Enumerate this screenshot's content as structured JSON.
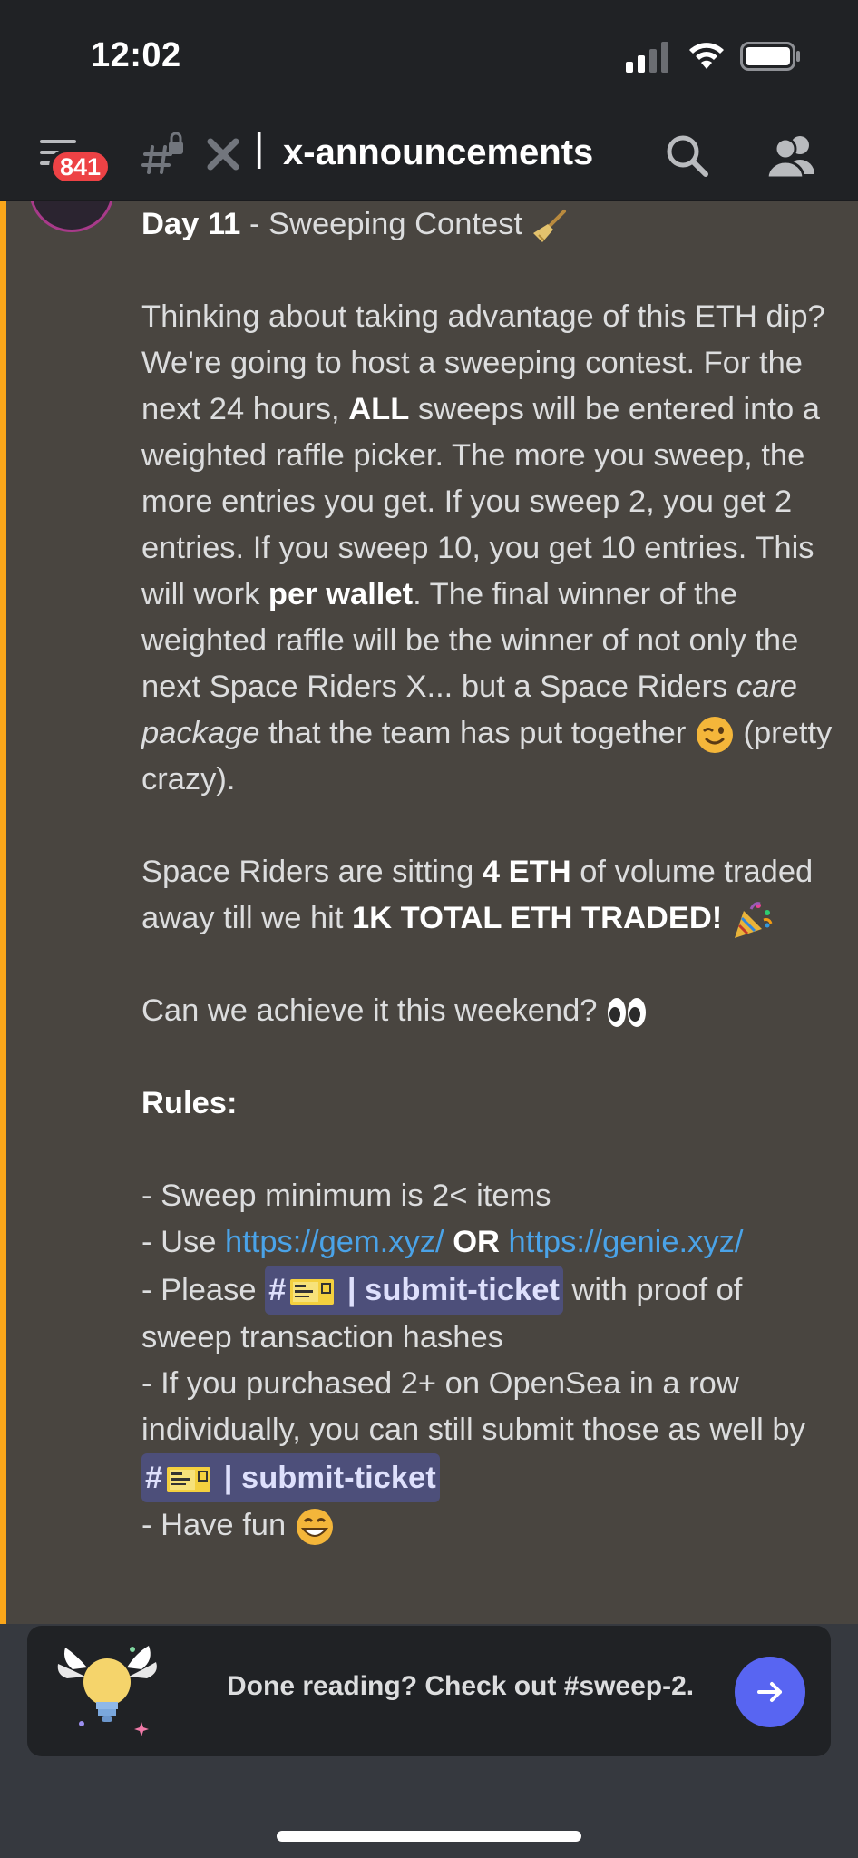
{
  "status_bar": {
    "time": "12:02"
  },
  "header": {
    "unread_count": "841",
    "divider": "|",
    "channel_name": "x-announcements"
  },
  "message": {
    "title_bold": "Day 11",
    "title_rest": " - Sweeping Contest ",
    "p1_a": "Thinking about taking advantage of this ETH dip? We're going to host a sweeping contest. For the next 24 hours, ",
    "p1_b": "ALL",
    "p1_c": " sweeps will be entered into a weighted raffle picker.  The more you sweep, the more entries you get.  If you sweep 2, you get 2 entries.  If you sweep 10, you get 10 entries.  This will work ",
    "p1_d": "per wallet",
    "p1_e": ". The final winner of the weighted raffle will be the winner of not only the next Space Riders X... but a Space Riders ",
    "p1_f": "care package",
    "p1_g": " that the team has put together ",
    "p1_h": " (pretty crazy).",
    "p2_a": "Space Riders are sitting ",
    "p2_b": "4 ETH",
    "p2_c": " of volume traded away till we hit ",
    "p2_d": "1K TOTAL ETH TRADED!",
    "p3": "Can we achieve it this weekend? ",
    "rules_heading": "Rules:",
    "rule1": "- Sweep minimum is 2< items",
    "rule2_a": "- Use ",
    "rule2_link1": "https://gem.xyz/",
    "rule2_or": "OR",
    "rule2_link2": "https://genie.xyz/",
    "rule3_a": "- Please ",
    "rule3_c": " with proof of sweep transaction hashes",
    "rule4_a": "- If you purchased 2+ on OpenSea in a row individually, you can still submit those as well by ",
    "rule5": "- Have fun ",
    "mention_hash": "#",
    "mention_label": " | submit-ticket"
  },
  "banner": {
    "text": "Done reading? Check out #sweep-2."
  },
  "icons": {
    "menu": "hamburger-icon",
    "channel": "locked-hash-icon",
    "muted": "x-icon",
    "search": "search-icon",
    "members": "members-icon",
    "banner": "winged-lightbulb-icon",
    "next": "arrow-right-icon"
  },
  "colors": {
    "badge": "#ed4245",
    "mention_bar": "#faa61a",
    "link": "#4aa3e8",
    "blurple": "#5865f2",
    "mention_bg": "#4d4f7a"
  }
}
